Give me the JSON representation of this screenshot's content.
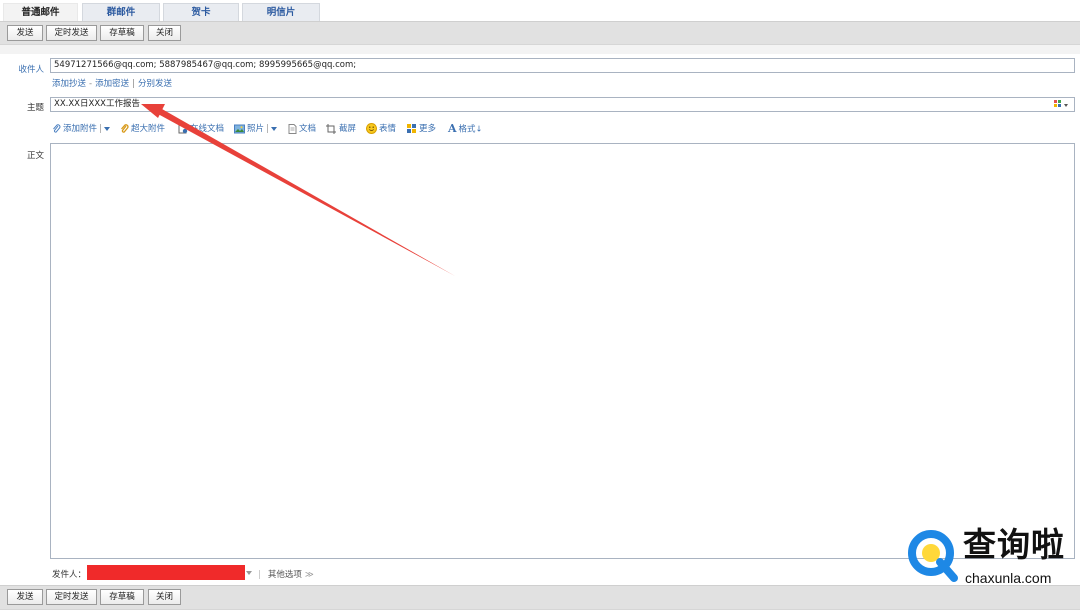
{
  "tabs": [
    {
      "label": "普通邮件",
      "active": true
    },
    {
      "label": "群邮件"
    },
    {
      "label": "贺卡"
    },
    {
      "label": "明信片"
    }
  ],
  "toolbar": {
    "send": "发送",
    "scheduled_send": "定时发送",
    "save_draft": "存草稿",
    "close": "关闭"
  },
  "form": {
    "to_label": "收件人",
    "to_value": "54971271566@qq.com; 5887985467@qq.com; 8995995665@qq.com;",
    "add_cc": "添加抄送",
    "add_bcc": "添加密送",
    "separate_send": "分别发送",
    "subject_label": "主题",
    "subject_value": "XX.XX日XXX工作报告",
    "body_label": "正文"
  },
  "format_toolbar": {
    "add_attachment": "添加附件",
    "large_attachment": "超大附件",
    "online_doc": "在线文档",
    "photo": "照片",
    "document": "文档",
    "screenshot": "截屏",
    "emoji": "表情",
    "more": "更多",
    "format": "格式"
  },
  "footer": {
    "sender_label": "发件人：",
    "other_options": "其他选项"
  },
  "watermark": {
    "title": "查询啦",
    "site": "chaxunla.com"
  },
  "colors": {
    "toolbar_bg": "#e1e1e1",
    "link": "#3a6fb0",
    "annotation_arrow": "#e8413a",
    "sender_mask": "#f02a2a",
    "watermark_blue": "#1e88e5"
  }
}
